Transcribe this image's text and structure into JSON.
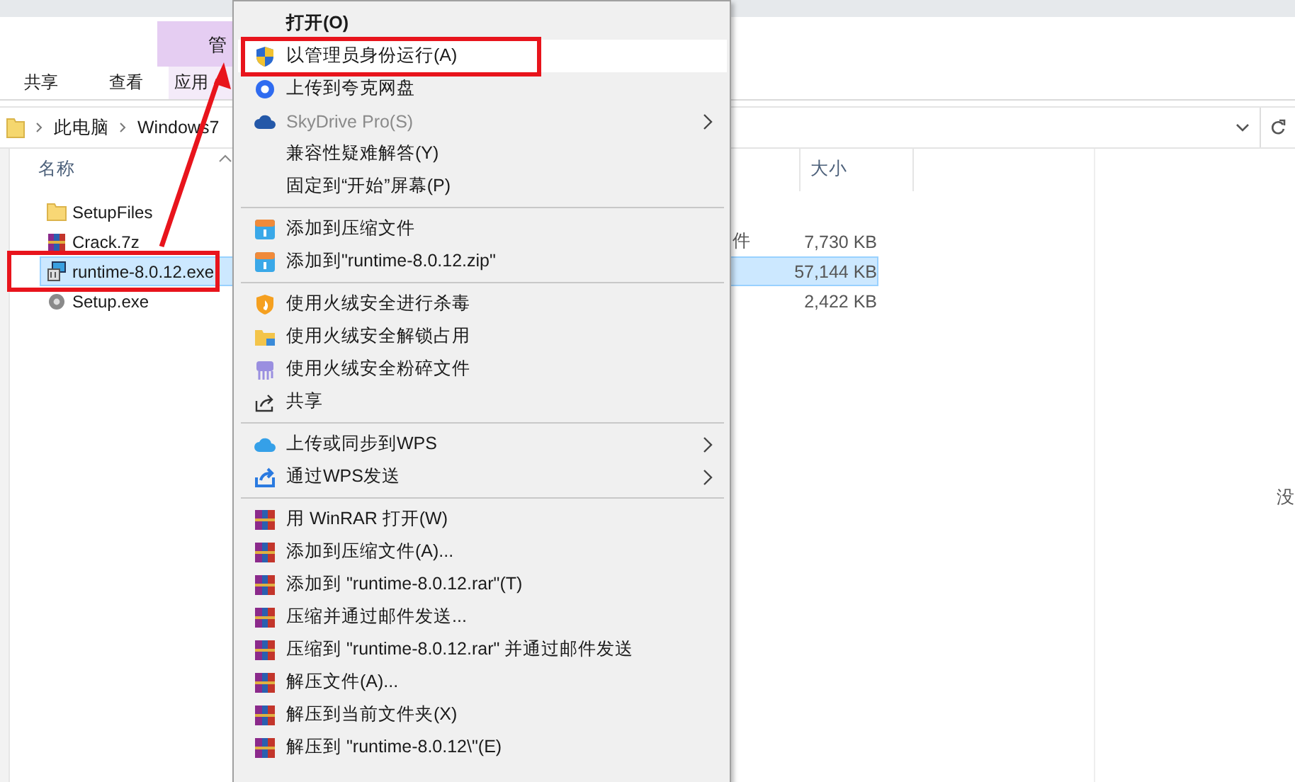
{
  "ribbon": {
    "context_tab": "管",
    "tabs": [
      {
        "label": "共享",
        "selected": false
      },
      {
        "label": "查看",
        "selected": false
      },
      {
        "label": "应用",
        "selected": false
      }
    ]
  },
  "address_bar": {
    "path": [
      "此电脑",
      "Windows7"
    ]
  },
  "file_list": {
    "columns": {
      "name": "名称",
      "size": "大小"
    },
    "rows": [
      {
        "name": "SetupFiles",
        "type": "",
        "size": "",
        "selected": false
      },
      {
        "name": "Crack.7z",
        "type": "件",
        "size": "7,730 KB",
        "selected": false
      },
      {
        "name": "runtime-8.0.12.exe",
        "type": "",
        "size": "57,144 KB",
        "selected": true
      },
      {
        "name": "Setup.exe",
        "type": "",
        "size": "2,422 KB",
        "selected": false
      }
    ]
  },
  "preview_pane": {
    "text": "没"
  },
  "context_menu": {
    "groups": [
      [
        {
          "label": "打开(O)",
          "default": true,
          "selected": false,
          "disabled": false,
          "submenu": false
        },
        {
          "label": "以管理员身份运行(A)",
          "default": false,
          "selected": true,
          "disabled": false,
          "submenu": false
        },
        {
          "label": "上传到夸克网盘",
          "default": false,
          "selected": false,
          "disabled": false,
          "submenu": false
        },
        {
          "label": "SkyDrive Pro(S)",
          "default": false,
          "selected": false,
          "disabled": true,
          "submenu": true
        },
        {
          "label": "兼容性疑难解答(Y)",
          "default": false,
          "selected": false,
          "disabled": false,
          "submenu": false
        },
        {
          "label": "固定到“开始”屏幕(P)",
          "default": false,
          "selected": false,
          "disabled": false,
          "submenu": false
        }
      ],
      [
        {
          "label": "添加到压缩文件",
          "default": false,
          "selected": false,
          "disabled": false,
          "submenu": false
        },
        {
          "label": "添加到\"runtime-8.0.12.zip\"",
          "default": false,
          "selected": false,
          "disabled": false,
          "submenu": false
        }
      ],
      [
        {
          "label": "使用火绒安全进行杀毒",
          "default": false,
          "selected": false,
          "disabled": false,
          "submenu": false
        },
        {
          "label": "使用火绒安全解锁占用",
          "default": false,
          "selected": false,
          "disabled": false,
          "submenu": false
        },
        {
          "label": "使用火绒安全粉碎文件",
          "default": false,
          "selected": false,
          "disabled": false,
          "submenu": false
        },
        {
          "label": "共享",
          "default": false,
          "selected": false,
          "disabled": false,
          "submenu": false
        }
      ],
      [
        {
          "label": "上传或同步到WPS",
          "default": false,
          "selected": false,
          "disabled": false,
          "submenu": true
        },
        {
          "label": "通过WPS发送",
          "default": false,
          "selected": false,
          "disabled": false,
          "submenu": true
        }
      ],
      [
        {
          "label": "用 WinRAR 打开(W)",
          "default": false,
          "selected": false,
          "disabled": false,
          "submenu": false
        },
        {
          "label": "添加到压缩文件(A)...",
          "default": false,
          "selected": false,
          "disabled": false,
          "submenu": false
        },
        {
          "label": "添加到 \"runtime-8.0.12.rar\"(T)",
          "default": false,
          "selected": false,
          "disabled": false,
          "submenu": false
        },
        {
          "label": "压缩并通过邮件发送...",
          "default": false,
          "selected": false,
          "disabled": false,
          "submenu": false
        },
        {
          "label": "压缩到 \"runtime-8.0.12.rar\" 并通过邮件发送",
          "default": false,
          "selected": false,
          "disabled": false,
          "submenu": false
        },
        {
          "label": "解压文件(A)...",
          "default": false,
          "selected": false,
          "disabled": false,
          "submenu": false
        },
        {
          "label": "解压到当前文件夹(X)",
          "default": false,
          "selected": false,
          "disabled": false,
          "submenu": false
        },
        {
          "label": "解压到 \"runtime-8.0.12\\\"(E)",
          "default": false,
          "selected": false,
          "disabled": false,
          "submenu": false
        }
      ]
    ]
  }
}
